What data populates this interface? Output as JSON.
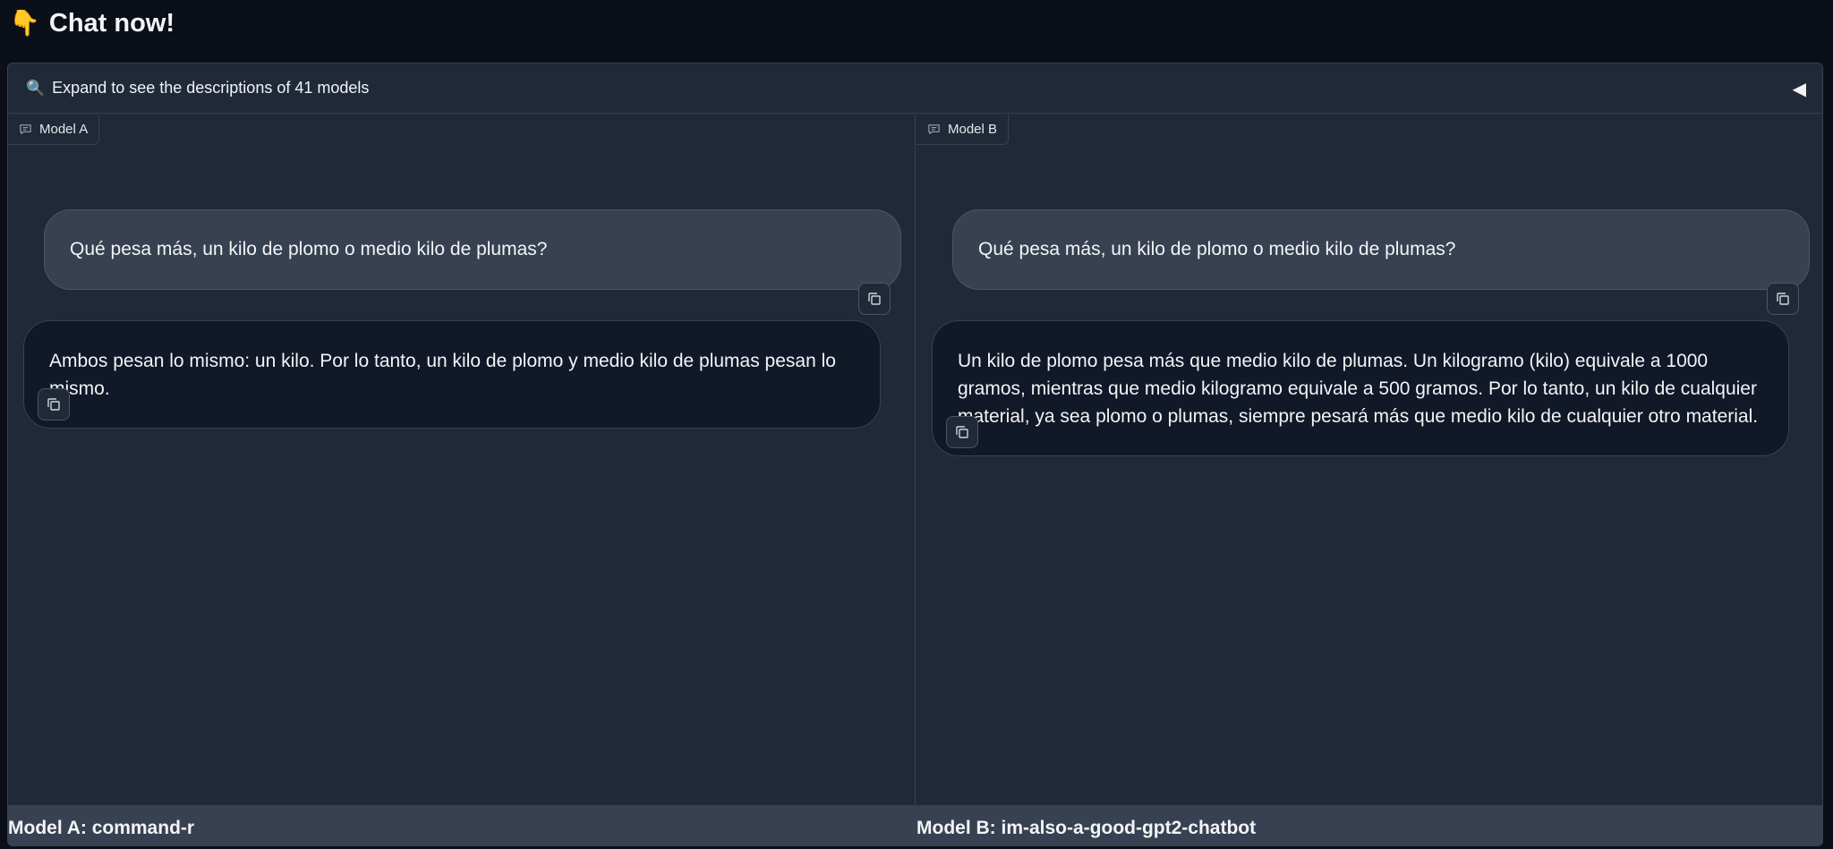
{
  "header": {
    "emoji": "👇",
    "title": "Chat now!"
  },
  "accordion": {
    "icon": "magnifier-icon",
    "label": "Expand to see the descriptions of 41 models",
    "toggle": "◀"
  },
  "model_a": {
    "tag": "Model A",
    "user_message": "Qué pesa más, un kilo de plomo o medio kilo de plumas?",
    "bot_message": "Ambos pesan lo mismo: un kilo. Por lo tanto, un kilo de plomo y medio kilo de plumas pesan lo mismo.",
    "footer": "Model A: command-r"
  },
  "model_b": {
    "tag": "Model B",
    "user_message": "Qué pesa más, un kilo de plomo o medio kilo de plumas?",
    "bot_message": "Un kilo de plomo pesa más que medio kilo de plumas. Un kilogramo (kilo) equivale a 1000 gramos, mientras que medio kilogramo equivale a 500 gramos. Por lo tanto, un kilo de cualquier material, ya sea plomo o plumas, siempre pesará más que medio kilo de cualquier otro material.",
    "footer": "Model B: im-also-a-good-gpt2-chatbot"
  },
  "colors": {
    "background": "#0b0f19",
    "panel": "#1f2937",
    "user_bubble": "#374151",
    "bot_bubble": "#111827",
    "accent": "#60a5fa"
  }
}
